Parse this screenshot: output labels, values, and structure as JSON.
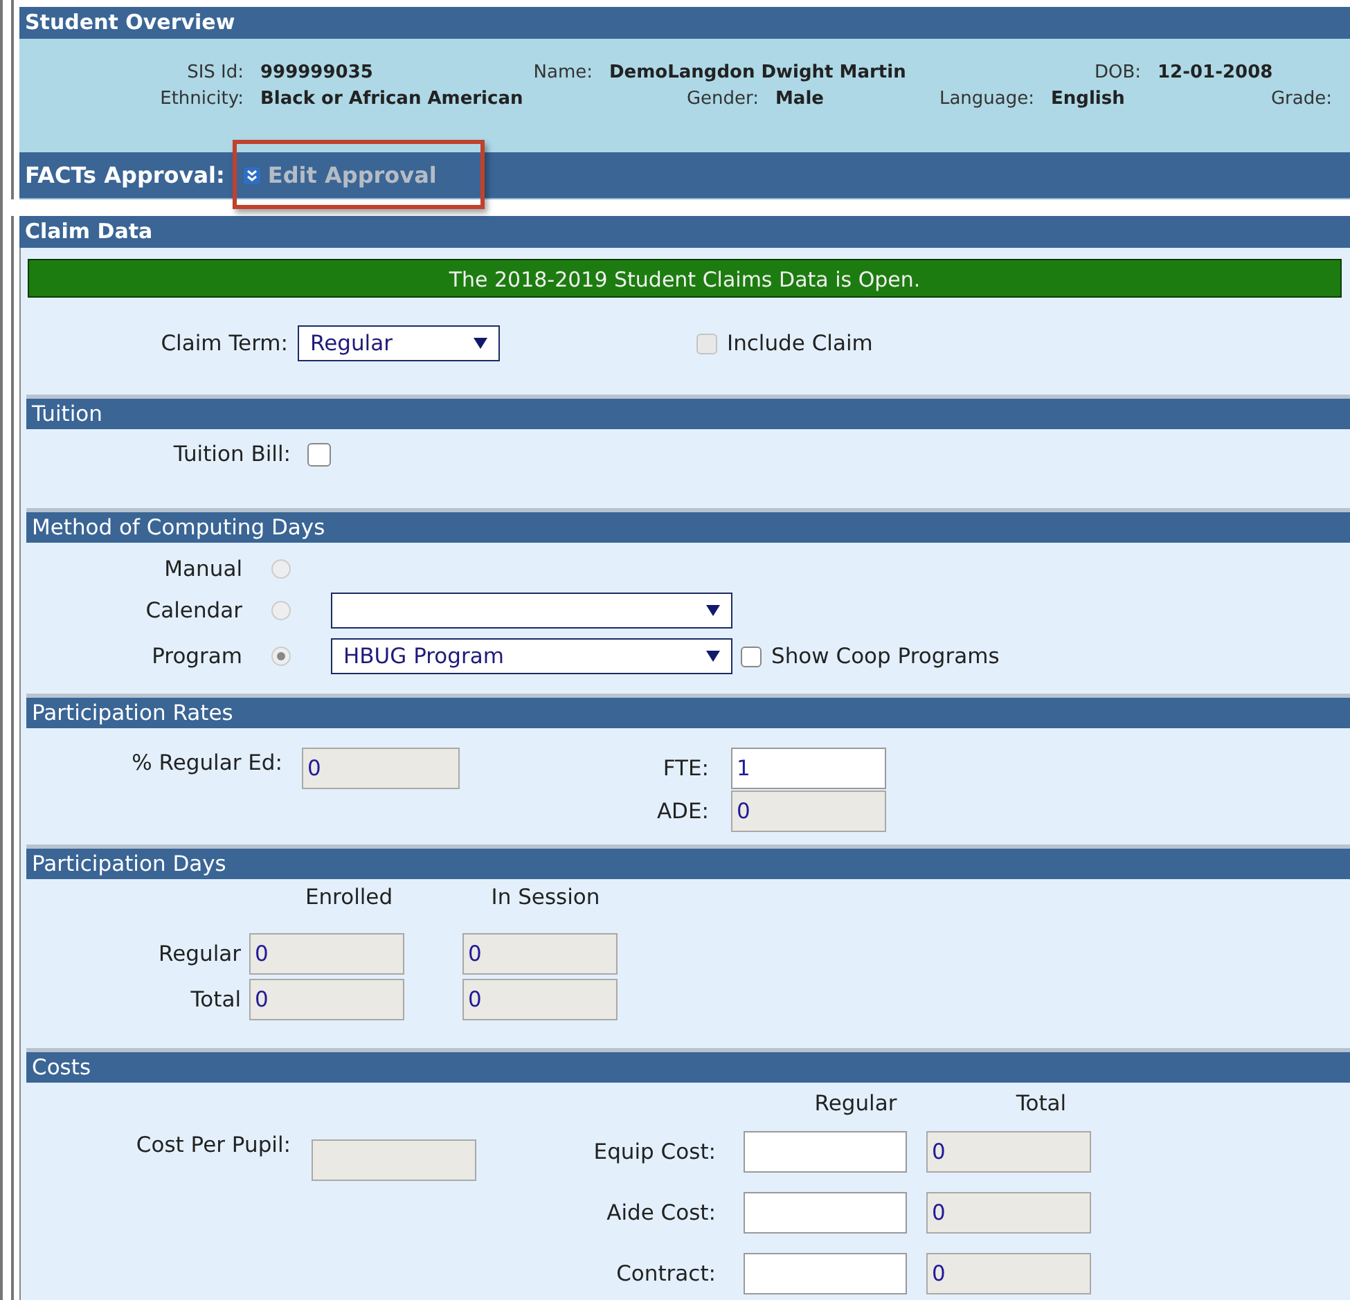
{
  "overview": {
    "title": "Student Overview",
    "rows": [
      [
        {
          "label": "SIS Id:",
          "value": "999999035"
        },
        {
          "label": "Name:",
          "value": "DemoLangdon Dwight Martin"
        },
        {
          "label": "DOB:",
          "value": "12-01-2008"
        }
      ],
      [
        {
          "label": "Ethnicity:",
          "value": "Black or African American"
        },
        {
          "label": "Gender:",
          "value": "Male"
        },
        {
          "label": "Language:",
          "value": "English"
        },
        {
          "label": "Grade:"
        }
      ]
    ]
  },
  "approval": {
    "label": "FACTs Approval:",
    "button": "Edit Approval",
    "highlighted": true
  },
  "claim_data": {
    "title": "Claim Data",
    "banner": "The 2018-2019 Student Claims Data is Open.",
    "claim_term": {
      "label": "Claim Term:",
      "value": "Regular"
    },
    "include_claim": {
      "label": "Include Claim",
      "checked": false,
      "disabled": true
    }
  },
  "tuition": {
    "title": "Tuition",
    "tuition_bill": {
      "label": "Tuition Bill:",
      "checked": false,
      "disabled": false
    }
  },
  "method": {
    "title": "Method of Computing Days",
    "options": [
      {
        "label": "Manual",
        "kind": "plain",
        "selected": false,
        "disabled": true
      },
      {
        "label": "Calendar",
        "kind": "dropdown",
        "selected": false,
        "disabled": true
      },
      {
        "label": "Program",
        "kind": "dropdown",
        "selected": true,
        "disabled": true,
        "value": "HBUG Program"
      }
    ],
    "show_coop": {
      "label": "Show Coop Programs",
      "checked": false,
      "disabled": false
    }
  },
  "participation_rates": {
    "title": "Participation Rates",
    "fields": [
      {
        "label": "% Regular Ed:",
        "value": "0",
        "disabled": true
      },
      {
        "label": "FTE:",
        "value": "1",
        "disabled": false
      },
      {
        "label": "ADE:",
        "value": "0",
        "disabled": true
      }
    ]
  },
  "participation_days": {
    "title": "Participation Days",
    "columns": [
      "Enrolled",
      "In Session"
    ],
    "rows": [
      {
        "label": "Regular",
        "values": [
          "0",
          "0"
        ],
        "disabled": true
      },
      {
        "label": "Total",
        "values": [
          "0",
          "0"
        ],
        "disabled": true
      }
    ]
  },
  "costs": {
    "title": "Costs",
    "columns": [
      "Regular",
      "Total"
    ],
    "cost_per_pupil": {
      "label": "Cost Per Pupil:",
      "disabled": true
    },
    "rows": [
      {
        "label": "Equip Cost:",
        "total": "0"
      },
      {
        "label": "Aide Cost:",
        "total": "0"
      },
      {
        "label": "Contract:",
        "total": "0"
      }
    ]
  }
}
